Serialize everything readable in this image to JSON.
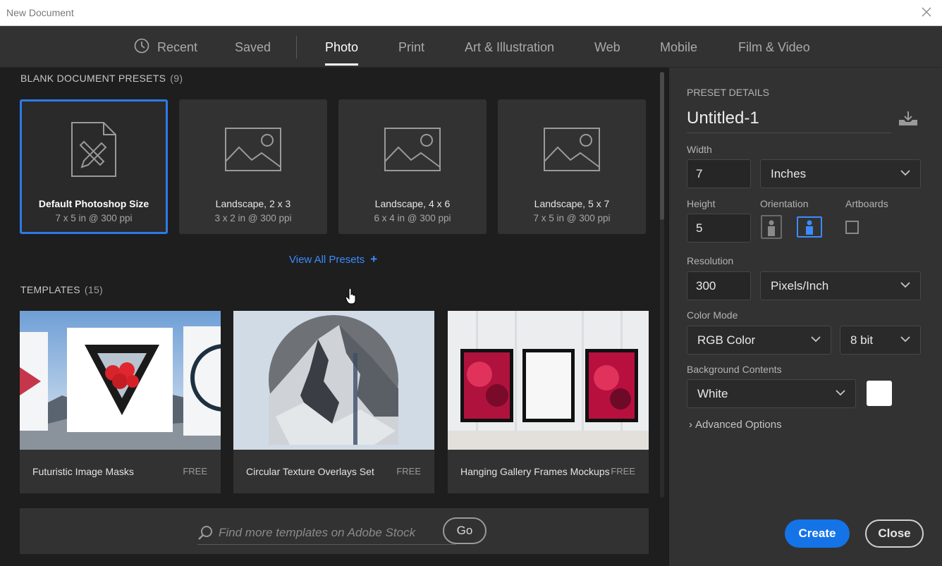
{
  "window": {
    "title": "New Document"
  },
  "tabs": [
    {
      "label": "Recent"
    },
    {
      "label": "Saved"
    },
    {
      "label": "Photo"
    },
    {
      "label": "Print"
    },
    {
      "label": "Art & Illustration"
    },
    {
      "label": "Web"
    },
    {
      "label": "Mobile"
    },
    {
      "label": "Film & Video"
    }
  ],
  "active_tab": "Photo",
  "presets_section": {
    "label": "BLANK DOCUMENT PRESETS",
    "count": "(9)"
  },
  "presets": [
    {
      "name": "Default Photoshop Size",
      "details": "7 x 5 in @ 300 ppi",
      "icon": "document-pencil-ruler-icon",
      "selected": true
    },
    {
      "name": "Landscape, 2 x 3",
      "details": "3 x 2 in @ 300 ppi",
      "icon": "image-placeholder-icon"
    },
    {
      "name": "Landscape, 4 x 6",
      "details": "6 x 4 in @ 300 ppi",
      "icon": "image-placeholder-icon"
    },
    {
      "name": "Landscape, 5 x 7",
      "details": "7 x 5 in @ 300 ppi",
      "icon": "image-placeholder-icon"
    }
  ],
  "view_all_presets": {
    "label": "View All Presets",
    "icon": "+"
  },
  "templates_section": {
    "label": "TEMPLATES",
    "count": "(15)"
  },
  "templates": [
    {
      "name": "Futuristic Image Masks",
      "price": "FREE"
    },
    {
      "name": "Circular Texture Overlays Set",
      "price": "FREE"
    },
    {
      "name": "Hanging Gallery Frames Mockups",
      "price": "FREE"
    }
  ],
  "stock_search": {
    "placeholder": "Find more templates on Adobe Stock",
    "go_label": "Go"
  },
  "preset_details": {
    "header": "PRESET DETAILS",
    "document_name": "Untitled-1",
    "width_label": "Width",
    "width_value": "7",
    "width_unit": "Inches",
    "height_label": "Height",
    "height_value": "5",
    "orientation_label": "Orientation",
    "orientation_selected": "landscape",
    "artboards_label": "Artboards",
    "artboards_checked": false,
    "resolution_label": "Resolution",
    "resolution_value": "300",
    "resolution_unit": "Pixels/Inch",
    "color_mode_label": "Color Mode",
    "color_mode": "RGB Color",
    "bit_depth": "8 bit",
    "background_label": "Background Contents",
    "background": "White",
    "background_swatch": "#ffffff",
    "advanced_label": "Advanced Options"
  },
  "buttons": {
    "create": "Create",
    "close": "Close"
  },
  "colors": {
    "accent": "#1473e6",
    "link": "#3b8bff",
    "panel": "#323232",
    "bg": "#1e1e1e"
  }
}
